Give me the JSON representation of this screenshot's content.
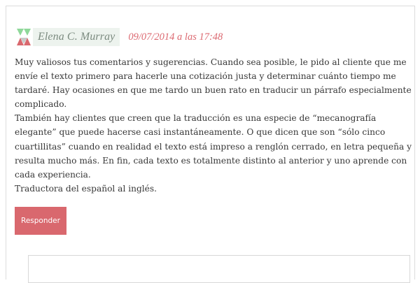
{
  "comment": {
    "author": "Elena C. Murray",
    "date": "09/07/2014 a las 17:48",
    "avatar_icon": "identicon-avatar",
    "paragraphs": [
      "Muy valiosos tus comentarios y sugerencias. Cuando sea posible, le pido al cliente que me envíe el texto primero para hacerle una cotización justa y determinar cuánto tiempo me tardaré. Hay ocasiones en que me tardo un buen rato en traducir un párrafo especialmente complicado.",
      "También hay clientes que creen que la traducción es una especie de “mecanografía elegante” que puede hacerse casi instantáneamente. O que dicen que son “sólo cinco cuartillitas” cuando en realidad el texto está impreso a renglón cerrado, en letra pequeña y resulta mucho más. En fin, cada texto es totalmente distinto al anterior y uno aprende con cada experiencia.",
      "Traductora del español al inglés."
    ],
    "reply_label": "Responder"
  },
  "colors": {
    "accent": "#d9686e",
    "date": "#dc6a72",
    "author_bg": "#edf3ee",
    "author_text": "#7c8b80"
  }
}
